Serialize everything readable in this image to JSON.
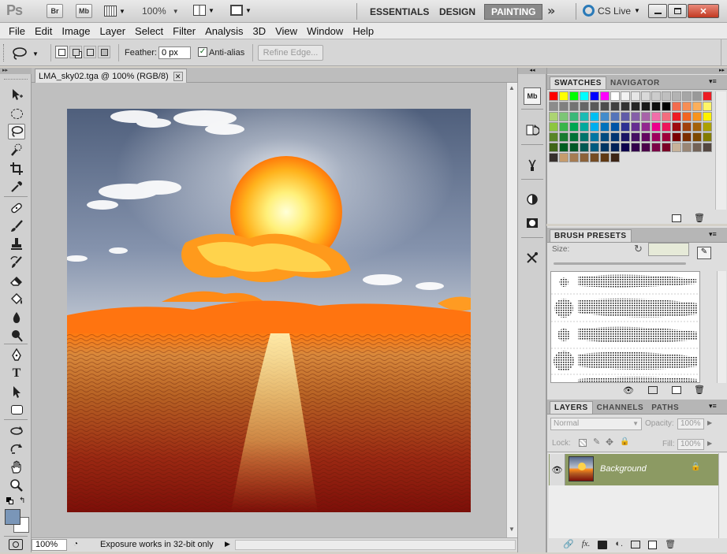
{
  "app": {
    "logo": "Ps",
    "buttons": [
      "Br",
      "Mb"
    ],
    "zoom": "100%",
    "workspaces": [
      "ESSENTIALS",
      "DESIGN",
      "PAINTING"
    ],
    "active_workspace": "PAINTING",
    "cs_live": "CS Live"
  },
  "menu": [
    "File",
    "Edit",
    "Image",
    "Layer",
    "Select",
    "Filter",
    "Analysis",
    "3D",
    "View",
    "Window",
    "Help"
  ],
  "options": {
    "feather_label": "Feather:",
    "feather_value": "0 px",
    "antialias_label": "Anti-alias",
    "antialias_checked": true,
    "refine_edge": "Refine Edge..."
  },
  "document": {
    "tab_title": "LMA_sky02.tga @ 100% (RGB/8)",
    "close": "✕"
  },
  "status": {
    "zoom": "100%",
    "message": "Exposure works in 32-bit only"
  },
  "swatches_panel": {
    "tabs": [
      "SWATCHES",
      "NAVIGATOR"
    ],
    "active": "SWATCHES",
    "colors": [
      "#ff0000",
      "#ffff00",
      "#00ff00",
      "#00ffff",
      "#0000ff",
      "#ff00ff",
      "#ffffff",
      "#f2f2f2",
      "#e6e6e6",
      "#d9d9d9",
      "#cccccc",
      "#bfbfbf",
      "#b3b3b3",
      "#a6a6a6",
      "#999999",
      "#ed1c24",
      "#8c8c8c",
      "#808080",
      "#737373",
      "#666666",
      "#595959",
      "#4d4d4d",
      "#404040",
      "#333333",
      "#262626",
      "#1a1a1a",
      "#0d0d0d",
      "#000000",
      "#f26c4f",
      "#f68e55",
      "#fbaf5c",
      "#fff467",
      "#acd372",
      "#7cc576",
      "#3bb878",
      "#1abbb4",
      "#00bff3",
      "#438ccb",
      "#5574b9",
      "#605ca8",
      "#855fa8",
      "#a763a8",
      "#f06ea9",
      "#f26d7d",
      "#ed1c24",
      "#f26522",
      "#f7941d",
      "#fff200",
      "#8dc63f",
      "#39b54a",
      "#00a651",
      "#00a99d",
      "#00aeef",
      "#0072bc",
      "#0054a6",
      "#2e3192",
      "#662d91",
      "#92278f",
      "#ec008c",
      "#ed145b",
      "#9e0b0f",
      "#a0410d",
      "#a3620a",
      "#aba000",
      "#598527",
      "#1a7b30",
      "#007236",
      "#00746b",
      "#0076a3",
      "#004b80",
      "#003471",
      "#1b1464",
      "#440e62",
      "#630460",
      "#9e005d",
      "#9e0039",
      "#790000",
      "#7b2e00",
      "#7d4900",
      "#827b00",
      "#406618",
      "#005e20",
      "#005826",
      "#005952",
      "#005b7f",
      "#003663",
      "#002157",
      "#0d004c",
      "#32004b",
      "#4b0049",
      "#7b0046",
      "#7a0026",
      "#c7b299",
      "#998675",
      "#736357",
      "#534741",
      "#37302d",
      "#c69c6d",
      "#a67c52",
      "#8c6239",
      "#754c24",
      "#603913",
      "#3c2415"
    ]
  },
  "brush_panel": {
    "tabs": [
      "BRUSH PRESETS"
    ],
    "size_label": "Size:"
  },
  "layers_panel": {
    "tabs": [
      "LAYERS",
      "CHANNELS",
      "PATHS"
    ],
    "active": "LAYERS",
    "blend_mode": "Normal",
    "opacity_label": "Opacity:",
    "opacity_value": "100%",
    "lock_label": "Lock:",
    "fill_label": "Fill:",
    "fill_value": "100%",
    "layers": [
      {
        "name": "Background",
        "visible": true,
        "locked": true
      }
    ]
  }
}
